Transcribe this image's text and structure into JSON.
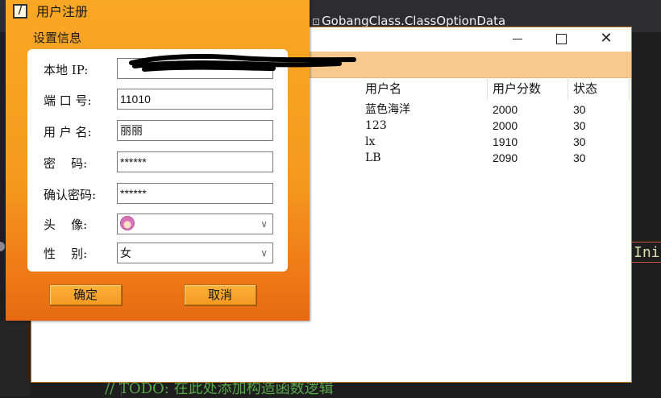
{
  "ide": {
    "tab_title": "GobangClass.ClassOptionData",
    "side_code": "Ini",
    "comment_line": "// TODO: 在此处添加构造函数逻辑"
  },
  "main_window": {
    "controls": {
      "minimize": "—",
      "maximize": "☐",
      "close": "✕"
    },
    "user_list": {
      "columns": [
        "用户名",
        "用户分数",
        "状态"
      ],
      "rows": [
        [
          "蓝色海洋",
          "2000",
          "30"
        ],
        [
          "123",
          "2000",
          "30"
        ],
        [
          "lx",
          "1910",
          "30"
        ],
        [
          "LB",
          "2090",
          "30"
        ]
      ]
    }
  },
  "dialog": {
    "title": "用户注册",
    "group_title": "设置信息",
    "fields": {
      "ip": {
        "label": "本地 IP:",
        "value": ""
      },
      "port": {
        "label": "端 口 号:",
        "value": "11010"
      },
      "user": {
        "label": "用 户 名:",
        "value": "丽丽"
      },
      "pwd": {
        "label": "密    码:",
        "value": "******"
      },
      "confirm": {
        "label": "确认密码:",
        "value": "******"
      },
      "avatar": {
        "label": "头    像:",
        "value": ""
      },
      "gender": {
        "label": "性    别:",
        "value": "女"
      }
    },
    "ok_label": "确定",
    "cancel_label": "取消"
  },
  "colors": {
    "dialog_orange": "#f59a1f",
    "menubar_peach": "#f8c98c",
    "ide_bg": "#1e1e1e"
  }
}
